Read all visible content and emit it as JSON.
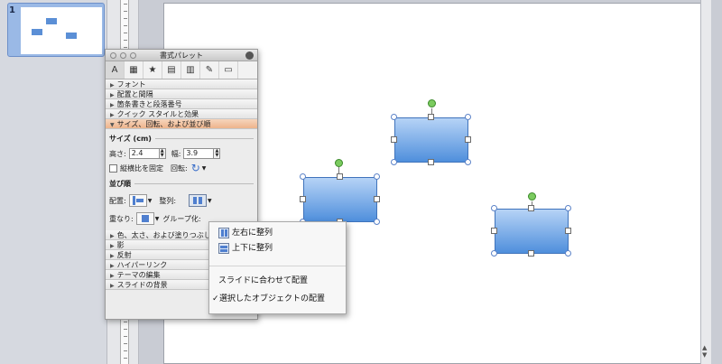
{
  "thumbnails": {
    "slide_number": "1"
  },
  "palette": {
    "title": "書式パレット",
    "sections": [
      {
        "label": "フォント"
      },
      {
        "label": "配置と間隔"
      },
      {
        "label": "箇条書きと段落番号"
      },
      {
        "label": "クイック スタイルと効果"
      },
      {
        "label": "サイズ、回転、および並び順"
      }
    ],
    "size": {
      "header": "サイズ (cm)",
      "height_label": "高さ:",
      "height_value": "2.4",
      "width_label": "幅:",
      "width_value": "3.9",
      "lock_ratio_label": "縦横比を固定",
      "rotation_label": "回転:"
    },
    "order": {
      "header": "並び順",
      "position_label": "配置:",
      "align_label": "整列:",
      "stacking_label": "重なり:",
      "group_label": "グループ化:"
    },
    "lower_sections": [
      {
        "label": "色、太さ、および塗りつぶし"
      },
      {
        "label": "影"
      },
      {
        "label": "反射"
      },
      {
        "label": "ハイパーリンク"
      },
      {
        "label": "テーマの編集"
      },
      {
        "label": "スライドの背景"
      }
    ]
  },
  "menu": {
    "items": [
      {
        "label": "左右に整列",
        "icon": "distribute-horizontal-icon"
      },
      {
        "label": "上下に整列",
        "icon": "distribute-vertical-icon"
      },
      {
        "label": "スライドに合わせて配置"
      },
      {
        "label": "選択したオブジェクトの配置",
        "checked": true
      }
    ],
    "check_mark": "✓"
  },
  "colors": {
    "shape_fill_top": "#b6d3f6",
    "shape_fill_bottom": "#4f8fdc",
    "section_open": "#eeb48c",
    "rotation_handle": "#7bcb5f"
  }
}
